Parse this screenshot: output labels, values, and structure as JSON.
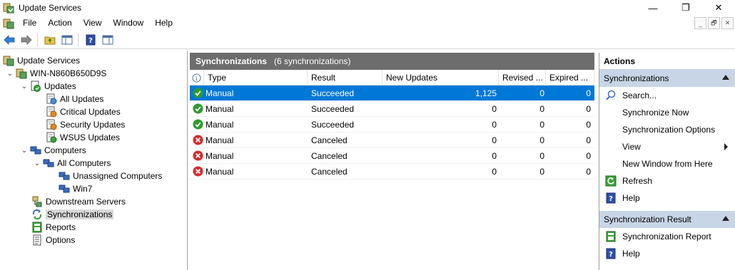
{
  "window": {
    "title": "Update Services",
    "minimize": "—",
    "restore": "❐",
    "close": "✕"
  },
  "menu": {
    "items": [
      "File",
      "Action",
      "View",
      "Window",
      "Help"
    ],
    "mdi_minimize": "_",
    "mdi_restore": "🗗",
    "mdi_close": "✕"
  },
  "toolbar": {
    "buttons": [
      "back-arrow-icon",
      "forward-arrow-icon",
      "up-folder-icon",
      "show-hide-tree-icon",
      "help-icon",
      "show-hide-action-pane-icon"
    ]
  },
  "tree": {
    "root": "Update Services",
    "server": "WIN-N860B650D9S",
    "updates": "Updates",
    "all_updates": "All Updates",
    "critical_updates": "Critical Updates",
    "security_updates": "Security Updates",
    "wsus_updates": "WSUS Updates",
    "computers": "Computers",
    "all_computers": "All Computers",
    "unassigned_computers": "Unassigned Computers",
    "win7": "Win7",
    "downstream_servers": "Downstream Servers",
    "synchronizations": "Synchronizations",
    "reports": "Reports",
    "options": "Options"
  },
  "center": {
    "title": "Synchronizations",
    "count": "(6 synchronizations)",
    "columns": {
      "type": "Type",
      "result": "Result",
      "new_updates": "New Updates",
      "revised": "Revised ...",
      "expired": "Expired ..."
    },
    "rows": [
      {
        "status": "success",
        "type": "Manual",
        "result": "Succeeded",
        "new_updates": "1,125",
        "revised": "0",
        "expired": "0"
      },
      {
        "status": "success",
        "type": "Manual",
        "result": "Succeeded",
        "new_updates": "0",
        "revised": "0",
        "expired": "0"
      },
      {
        "status": "success",
        "type": "Manual",
        "result": "Succeeded",
        "new_updates": "0",
        "revised": "0",
        "expired": "0"
      },
      {
        "status": "error",
        "type": "Manual",
        "result": "Canceled",
        "new_updates": "0",
        "revised": "0",
        "expired": "0"
      },
      {
        "status": "error",
        "type": "Manual",
        "result": "Canceled",
        "new_updates": "0",
        "revised": "0",
        "expired": "0"
      },
      {
        "status": "error",
        "type": "Manual",
        "result": "Canceled",
        "new_updates": "0",
        "revised": "0",
        "expired": "0"
      }
    ],
    "selected_row": 0
  },
  "actions": {
    "title": "Actions",
    "section1": "Synchronizations",
    "search": "Search...",
    "synchronize_now": "Synchronize Now",
    "sync_options": "Synchronization Options",
    "view": "View",
    "new_window": "New Window from Here",
    "refresh": "Refresh",
    "help": "Help",
    "section2": "Synchronization Result",
    "sync_report": "Synchronization Report",
    "help2": "Help"
  },
  "colors": {
    "selection": "#0078d7",
    "header_bar": "#6d6d6d",
    "action_section": "#c7d5e6",
    "success": "#2e9b2e",
    "error": "#d62b2b"
  }
}
